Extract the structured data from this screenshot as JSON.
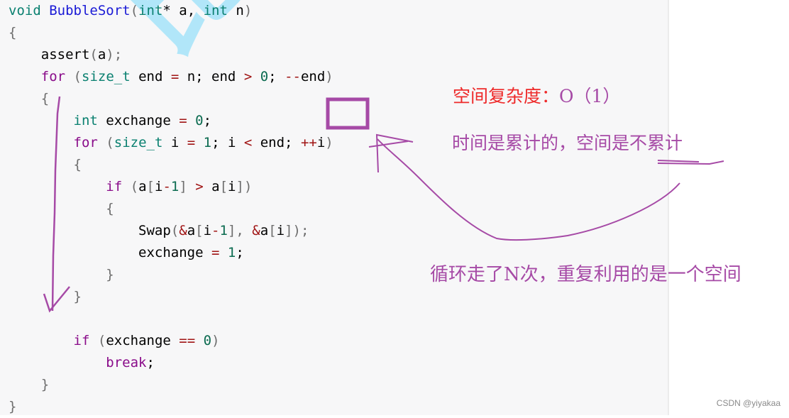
{
  "code_lines": [
    [
      {
        "t": "void",
        "c": "ty"
      },
      {
        "t": " "
      },
      {
        "t": "BubbleSort",
        "c": "fn"
      },
      {
        "t": "(",
        "c": "pu"
      },
      {
        "t": "int",
        "c": "ty"
      },
      {
        "t": "* a, "
      },
      {
        "t": "int",
        "c": "ty"
      },
      {
        "t": " n"
      },
      {
        "t": ")",
        "c": "pu"
      }
    ],
    [
      {
        "t": "{",
        "c": "pu"
      }
    ],
    [
      {
        "t": "    assert"
      },
      {
        "t": "(",
        "c": "pu"
      },
      {
        "t": "a"
      },
      {
        "t": ");",
        "c": "pu"
      }
    ],
    [
      {
        "t": "    "
      },
      {
        "t": "for",
        "c": "kw"
      },
      {
        "t": " "
      },
      {
        "t": "(",
        "c": "pu"
      },
      {
        "t": "size_t",
        "c": "ty"
      },
      {
        "t": " end "
      },
      {
        "t": "=",
        "c": "op"
      },
      {
        "t": " n; end "
      },
      {
        "t": ">",
        "c": "op"
      },
      {
        "t": " "
      },
      {
        "t": "0",
        "c": "num"
      },
      {
        "t": "; "
      },
      {
        "t": "--",
        "c": "op"
      },
      {
        "t": "end"
      },
      {
        "t": ")",
        "c": "pu"
      }
    ],
    [
      {
        "t": "    "
      },
      {
        "t": "{",
        "c": "pu"
      }
    ],
    [
      {
        "t": "        "
      },
      {
        "t": "int",
        "c": "ty"
      },
      {
        "t": " exchange "
      },
      {
        "t": "=",
        "c": "op"
      },
      {
        "t": " "
      },
      {
        "t": "0",
        "c": "num"
      },
      {
        "t": ";"
      }
    ],
    [
      {
        "t": "        "
      },
      {
        "t": "for",
        "c": "kw"
      },
      {
        "t": " "
      },
      {
        "t": "(",
        "c": "pu"
      },
      {
        "t": "size_t",
        "c": "ty"
      },
      {
        "t": " i "
      },
      {
        "t": "=",
        "c": "op"
      },
      {
        "t": " "
      },
      {
        "t": "1",
        "c": "num"
      },
      {
        "t": "; i "
      },
      {
        "t": "<",
        "c": "op"
      },
      {
        "t": " end; "
      },
      {
        "t": "++",
        "c": "op"
      },
      {
        "t": "i"
      },
      {
        "t": ")",
        "c": "pu"
      }
    ],
    [
      {
        "t": "        "
      },
      {
        "t": "{",
        "c": "pu"
      }
    ],
    [
      {
        "t": "            "
      },
      {
        "t": "if",
        "c": "kw"
      },
      {
        "t": " "
      },
      {
        "t": "(",
        "c": "pu"
      },
      {
        "t": "a"
      },
      {
        "t": "[",
        "c": "pu"
      },
      {
        "t": "i"
      },
      {
        "t": "-",
        "c": "op"
      },
      {
        "t": "1",
        "c": "num"
      },
      {
        "t": "]",
        "c": "pu"
      },
      {
        "t": " "
      },
      {
        "t": ">",
        "c": "op"
      },
      {
        "t": " a"
      },
      {
        "t": "[",
        "c": "pu"
      },
      {
        "t": "i"
      },
      {
        "t": "])",
        "c": "pu"
      }
    ],
    [
      {
        "t": "            "
      },
      {
        "t": "{",
        "c": "pu"
      }
    ],
    [
      {
        "t": "                Swap"
      },
      {
        "t": "(",
        "c": "pu"
      },
      {
        "t": "&",
        "c": "op"
      },
      {
        "t": "a"
      },
      {
        "t": "[",
        "c": "pu"
      },
      {
        "t": "i"
      },
      {
        "t": "-",
        "c": "op"
      },
      {
        "t": "1",
        "c": "num"
      },
      {
        "t": "],",
        "c": "pu"
      },
      {
        "t": " "
      },
      {
        "t": "&",
        "c": "op"
      },
      {
        "t": "a"
      },
      {
        "t": "[",
        "c": "pu"
      },
      {
        "t": "i"
      },
      {
        "t": "]);",
        "c": "pu"
      }
    ],
    [
      {
        "t": "                exchange "
      },
      {
        "t": "=",
        "c": "op"
      },
      {
        "t": " "
      },
      {
        "t": "1",
        "c": "num"
      },
      {
        "t": ";"
      }
    ],
    [
      {
        "t": "            "
      },
      {
        "t": "}",
        "c": "pu"
      }
    ],
    [
      {
        "t": "        "
      },
      {
        "t": "}",
        "c": "pu"
      }
    ],
    [
      {
        "t": ""
      }
    ],
    [
      {
        "t": "        "
      },
      {
        "t": "if",
        "c": "kw"
      },
      {
        "t": " "
      },
      {
        "t": "(",
        "c": "pu"
      },
      {
        "t": "exchange "
      },
      {
        "t": "==",
        "c": "op"
      },
      {
        "t": " "
      },
      {
        "t": "0",
        "c": "num"
      },
      {
        "t": ")",
        "c": "pu"
      }
    ],
    [
      {
        "t": "            "
      },
      {
        "t": "break",
        "c": "kw"
      },
      {
        "t": ";"
      }
    ],
    [
      {
        "t": "    "
      },
      {
        "t": "}",
        "c": "pu"
      }
    ],
    [
      {
        "t": "}",
        "c": "pu"
      }
    ]
  ],
  "watermark": "比特就业",
  "annotations": {
    "space_complexity_label": "空间复杂度：",
    "space_complexity_value": "O（1）",
    "time_vs_space": "时间是累计的，空间是不累计",
    "loop_reuse": "循环走了N次，重复利用的是一个空间"
  },
  "credit": "CSDN @yiyakaa",
  "colors": {
    "ink": "#a64aa6",
    "red_label": "#ee2a2a",
    "watermark": "#aee6fa"
  }
}
